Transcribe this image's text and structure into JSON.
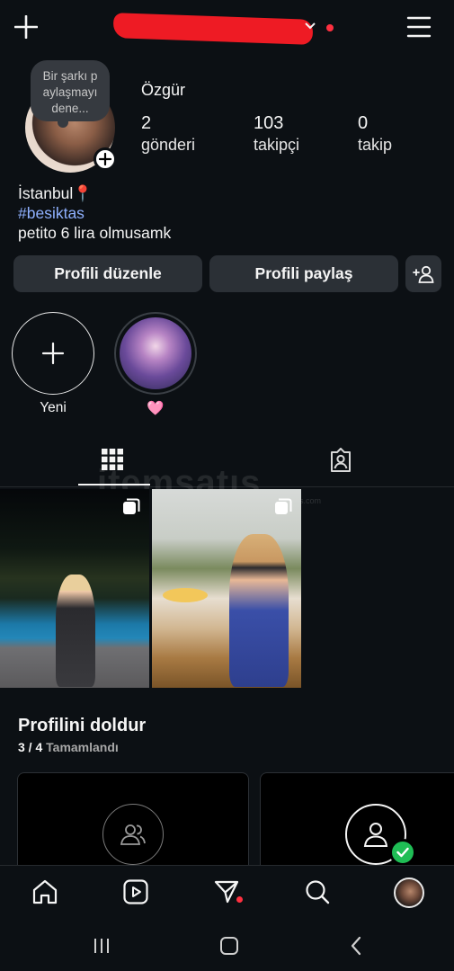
{
  "header": {
    "username": "",
    "plus_icon": "plus-icon",
    "menu_icon": "hamburger-menu-icon"
  },
  "profile": {
    "note": "Bir şarkı p aylaşmayı dene...",
    "name": "Özgür",
    "stats": [
      {
        "value": "2",
        "label": "gönderi"
      },
      {
        "value": "103",
        "label": "takipçi"
      },
      {
        "value": "0",
        "label": "takip"
      }
    ],
    "bio": {
      "line1": "İstanbul📍",
      "hashtag": "#besiktas",
      "line3": "petito 6 lira olmusamk"
    }
  },
  "buttons": {
    "edit_profile": "Profili düzenle",
    "share_profile": "Profili paylaş",
    "discover_people_icon": "add-person-icon"
  },
  "highlights": [
    {
      "label": "Yeni"
    },
    {
      "label": "🩷"
    }
  ],
  "watermark": {
    "text": "itemsatış",
    "sub": "itemsatis.com"
  },
  "completion": {
    "title": "Profilini doldur",
    "progress": "3 / 4",
    "progress_label": "Tamamlandı",
    "progress_fraction": 0.75
  },
  "colors": {
    "background": "#0c1014",
    "button": "#2b3036",
    "hashtag": "#8fb1ff",
    "notification_dot": "#ff3040",
    "check_green": "#1fbd55"
  }
}
